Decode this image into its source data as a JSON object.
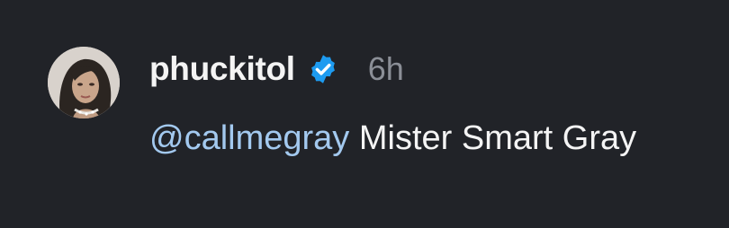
{
  "comment": {
    "username": "phuckitol",
    "verified": true,
    "timestamp": "6h",
    "mention": "@callmegray",
    "text": " Mister Smart Gray"
  },
  "colors": {
    "background": "#212328",
    "primary_text": "#f4f4f4",
    "secondary_text": "#8b8f97",
    "mention": "#a3c9ef",
    "verified_badge": "#1d9bf0"
  },
  "icons": {
    "avatar": "profile-avatar",
    "badge": "verified-badge-icon"
  }
}
